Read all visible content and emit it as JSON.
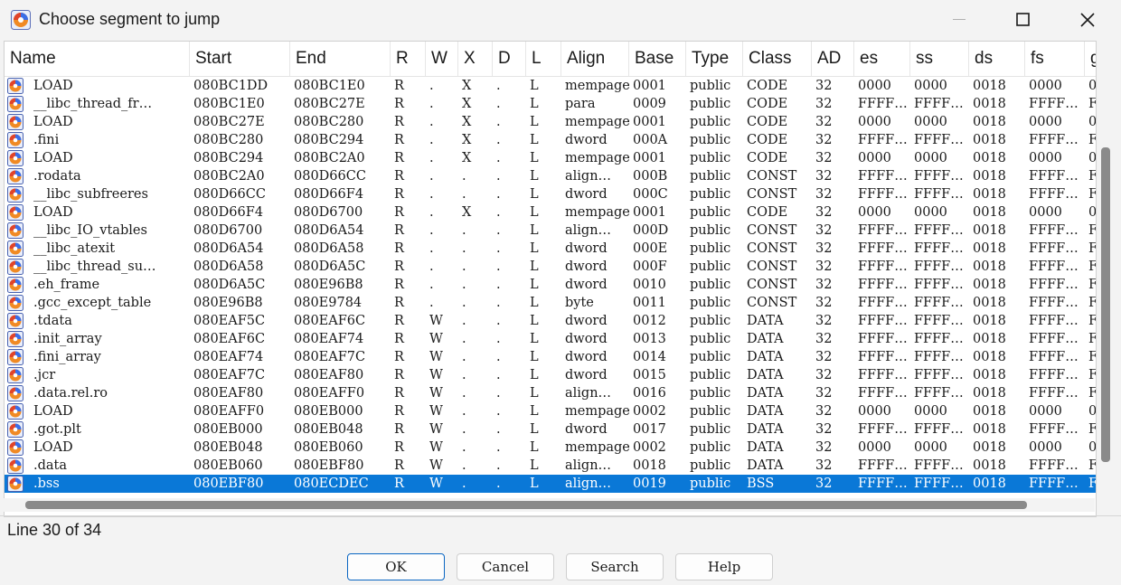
{
  "window": {
    "title": "Choose segment to jump",
    "minimize_icon": "minimize-icon",
    "maximize_icon": "maximize-icon",
    "close_icon": "close-icon"
  },
  "columns": [
    "Name",
    "Start",
    "End",
    "R",
    "W",
    "X",
    "D",
    "L",
    "Align",
    "Base",
    "Type",
    "Class",
    "AD",
    "es",
    "ss",
    "ds",
    "fs",
    "g"
  ],
  "rows": [
    [
      "LOAD",
      "080BC1DD",
      "080BC1E0",
      "R",
      ".",
      "X",
      ".",
      "L",
      "mempage",
      "0001",
      "public",
      "CODE",
      "32",
      "0000",
      "0000",
      "0018",
      "0000",
      "0"
    ],
    [
      "__libc_thread_fr…",
      "080BC1E0",
      "080BC27E",
      "R",
      ".",
      "X",
      ".",
      "L",
      "para",
      "0009",
      "public",
      "CODE",
      "32",
      "FFFF…",
      "FFFF…",
      "0018",
      "FFFF…",
      "F"
    ],
    [
      "LOAD",
      "080BC27E",
      "080BC280",
      "R",
      ".",
      "X",
      ".",
      "L",
      "mempage",
      "0001",
      "public",
      "CODE",
      "32",
      "0000",
      "0000",
      "0018",
      "0000",
      "0"
    ],
    [
      ".fini",
      "080BC280",
      "080BC294",
      "R",
      ".",
      "X",
      ".",
      "L",
      "dword",
      "000A",
      "public",
      "CODE",
      "32",
      "FFFF…",
      "FFFF…",
      "0018",
      "FFFF…",
      "F"
    ],
    [
      "LOAD",
      "080BC294",
      "080BC2A0",
      "R",
      ".",
      "X",
      ".",
      "L",
      "mempage",
      "0001",
      "public",
      "CODE",
      "32",
      "0000",
      "0000",
      "0018",
      "0000",
      "0"
    ],
    [
      ".rodata",
      "080BC2A0",
      "080D66CC",
      "R",
      ".",
      ".",
      ".",
      "L",
      "align…",
      "000B",
      "public",
      "CONST",
      "32",
      "FFFF…",
      "FFFF…",
      "0018",
      "FFFF…",
      "F"
    ],
    [
      "__libc_subfreeres",
      "080D66CC",
      "080D66F4",
      "R",
      ".",
      ".",
      ".",
      "L",
      "dword",
      "000C",
      "public",
      "CONST",
      "32",
      "FFFF…",
      "FFFF…",
      "0018",
      "FFFF…",
      "F"
    ],
    [
      "LOAD",
      "080D66F4",
      "080D6700",
      "R",
      ".",
      "X",
      ".",
      "L",
      "mempage",
      "0001",
      "public",
      "CODE",
      "32",
      "0000",
      "0000",
      "0018",
      "0000",
      "0"
    ],
    [
      "__libc_IO_vtables",
      "080D6700",
      "080D6A54",
      "R",
      ".",
      ".",
      ".",
      "L",
      "align…",
      "000D",
      "public",
      "CONST",
      "32",
      "FFFF…",
      "FFFF…",
      "0018",
      "FFFF…",
      "F"
    ],
    [
      "__libc_atexit",
      "080D6A54",
      "080D6A58",
      "R",
      ".",
      ".",
      ".",
      "L",
      "dword",
      "000E",
      "public",
      "CONST",
      "32",
      "FFFF…",
      "FFFF…",
      "0018",
      "FFFF…",
      "F"
    ],
    [
      "__libc_thread_su…",
      "080D6A58",
      "080D6A5C",
      "R",
      ".",
      ".",
      ".",
      "L",
      "dword",
      "000F",
      "public",
      "CONST",
      "32",
      "FFFF…",
      "FFFF…",
      "0018",
      "FFFF…",
      "F"
    ],
    [
      ".eh_frame",
      "080D6A5C",
      "080E96B8",
      "R",
      ".",
      ".",
      ".",
      "L",
      "dword",
      "0010",
      "public",
      "CONST",
      "32",
      "FFFF…",
      "FFFF…",
      "0018",
      "FFFF…",
      "F"
    ],
    [
      ".gcc_except_table",
      "080E96B8",
      "080E9784",
      "R",
      ".",
      ".",
      ".",
      "L",
      "byte",
      "0011",
      "public",
      "CONST",
      "32",
      "FFFF…",
      "FFFF…",
      "0018",
      "FFFF…",
      "F"
    ],
    [
      ".tdata",
      "080EAF5C",
      "080EAF6C",
      "R",
      "W",
      ".",
      ".",
      "L",
      "dword",
      "0012",
      "public",
      "DATA",
      "32",
      "FFFF…",
      "FFFF…",
      "0018",
      "FFFF…",
      "F"
    ],
    [
      ".init_array",
      "080EAF6C",
      "080EAF74",
      "R",
      "W",
      ".",
      ".",
      "L",
      "dword",
      "0013",
      "public",
      "DATA",
      "32",
      "FFFF…",
      "FFFF…",
      "0018",
      "FFFF…",
      "F"
    ],
    [
      ".fini_array",
      "080EAF74",
      "080EAF7C",
      "R",
      "W",
      ".",
      ".",
      "L",
      "dword",
      "0014",
      "public",
      "DATA",
      "32",
      "FFFF…",
      "FFFF…",
      "0018",
      "FFFF…",
      "F"
    ],
    [
      ".jcr",
      "080EAF7C",
      "080EAF80",
      "R",
      "W",
      ".",
      ".",
      "L",
      "dword",
      "0015",
      "public",
      "DATA",
      "32",
      "FFFF…",
      "FFFF…",
      "0018",
      "FFFF…",
      "F"
    ],
    [
      ".data.rel.ro",
      "080EAF80",
      "080EAFF0",
      "R",
      "W",
      ".",
      ".",
      "L",
      "align…",
      "0016",
      "public",
      "DATA",
      "32",
      "FFFF…",
      "FFFF…",
      "0018",
      "FFFF…",
      "F"
    ],
    [
      "LOAD",
      "080EAFF0",
      "080EB000",
      "R",
      "W",
      ".",
      ".",
      "L",
      "mempage",
      "0002",
      "public",
      "DATA",
      "32",
      "0000",
      "0000",
      "0018",
      "0000",
      "0"
    ],
    [
      ".got.plt",
      "080EB000",
      "080EB048",
      "R",
      "W",
      ".",
      ".",
      "L",
      "dword",
      "0017",
      "public",
      "DATA",
      "32",
      "FFFF…",
      "FFFF…",
      "0018",
      "FFFF…",
      "F"
    ],
    [
      "LOAD",
      "080EB048",
      "080EB060",
      "R",
      "W",
      ".",
      ".",
      "L",
      "mempage",
      "0002",
      "public",
      "DATA",
      "32",
      "0000",
      "0000",
      "0018",
      "0000",
      "0"
    ],
    [
      ".data",
      "080EB060",
      "080EBF80",
      "R",
      "W",
      ".",
      ".",
      "L",
      "align…",
      "0018",
      "public",
      "DATA",
      "32",
      "FFFF…",
      "FFFF…",
      "0018",
      "FFFF…",
      "F"
    ],
    [
      ".bss",
      "080EBF80",
      "080ECDEC",
      "R",
      "W",
      ".",
      ".",
      "L",
      "align…",
      "0019",
      "public",
      "BSS",
      "32",
      "FFFF…",
      "FFFF…",
      "0018",
      "FFFF…",
      "F"
    ]
  ],
  "selected_row": 22,
  "status": "Line 30 of 34",
  "buttons": {
    "ok": "OK",
    "cancel": "Cancel",
    "search": "Search",
    "help": "Help"
  },
  "colors": {
    "selection": "#0a78d7",
    "background": "#f3f3f3"
  }
}
